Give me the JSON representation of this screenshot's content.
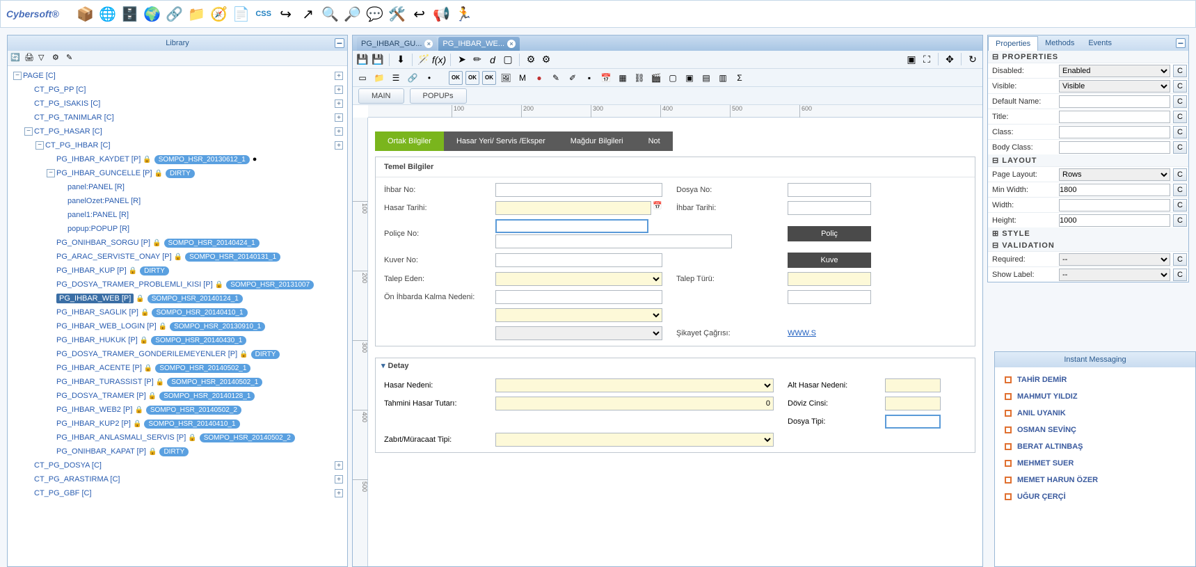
{
  "brand": "Cybersoft®",
  "library": {
    "title": "Library"
  },
  "tree": [
    {
      "d": 0,
      "exp": "-",
      "label": "PAGE [C]",
      "plus": true
    },
    {
      "d": 1,
      "exp": "",
      "label": "CT_PG_PP [C]",
      "plus": true
    },
    {
      "d": 1,
      "exp": "",
      "label": "CT_PG_ISAKIS [C]",
      "plus": true
    },
    {
      "d": 1,
      "exp": "",
      "label": "CT_PG_TANIMLAR [C]",
      "plus": true
    },
    {
      "d": 1,
      "exp": "-",
      "label": "CT_PG_HASAR [C]",
      "plus": true
    },
    {
      "d": 2,
      "exp": "-",
      "label": "CT_PG_IHBAR [C]",
      "plus": true
    },
    {
      "d": 3,
      "exp": "",
      "label": "PG_IHBAR_KAYDET [P]",
      "lock": "y",
      "badge": "SOMPO_HSR_20130612_1",
      "extra": "●"
    },
    {
      "d": 3,
      "exp": "-",
      "label": "PG_IHBAR_GUNCELLE [P]",
      "lock": "b",
      "badge": "DIRTY"
    },
    {
      "d": 4,
      "exp": "",
      "label": "panel:PANEL [R]"
    },
    {
      "d": 4,
      "exp": "",
      "label": "panelOzet:PANEL [R]"
    },
    {
      "d": 4,
      "exp": "",
      "label": "panel1:PANEL [R]"
    },
    {
      "d": 4,
      "exp": "",
      "label": "popup:POPUP [R]"
    },
    {
      "d": 3,
      "exp": "",
      "label": "PG_ONIHBAR_SORGU [P]",
      "lock": "y",
      "badge": "SOMPO_HSR_20140424_1"
    },
    {
      "d": 3,
      "exp": "",
      "label": "PG_ARAC_SERVISTE_ONAY [P]",
      "lock": "y",
      "badge": "SOMPO_HSR_20140131_1"
    },
    {
      "d": 3,
      "exp": "",
      "label": "PG_IHBAR_KUP [P]",
      "lock": "b",
      "badge": "DIRTY"
    },
    {
      "d": 3,
      "exp": "",
      "label": "PG_DOSYA_TRAMER_PROBLEMLI_KISI [P]",
      "lock": "y",
      "badge": "SOMPO_HSR_20131007"
    },
    {
      "d": 3,
      "exp": "",
      "label": "PG_IHBAR_WEB [P]",
      "lock": "y",
      "badge": "SOMPO_HSR_20140124_1",
      "selected": true
    },
    {
      "d": 3,
      "exp": "",
      "label": "PG_IHBAR_SAGLIK [P]",
      "lock": "y",
      "badge": "SOMPO_HSR_20140410_1"
    },
    {
      "d": 3,
      "exp": "",
      "label": "PG_IHBAR_WEB_LOGIN [P]",
      "lock": "y",
      "badge": "SOMPO_HSR_20130910_1"
    },
    {
      "d": 3,
      "exp": "",
      "label": "PG_IHBAR_HUKUK [P]",
      "lock": "y",
      "badge": "SOMPO_HSR_20140430_1"
    },
    {
      "d": 3,
      "exp": "",
      "label": "PG_DOSYA_TRAMER_GONDERILEMEYENLER [P]",
      "lock": "b",
      "badge": "DIRTY"
    },
    {
      "d": 3,
      "exp": "",
      "label": "PG_IHBAR_ACENTE [P]",
      "lock": "y",
      "badge": "SOMPO_HSR_20140502_1"
    },
    {
      "d": 3,
      "exp": "",
      "label": "PG_IHBAR_TURASSIST [P]",
      "lock": "y",
      "badge": "SOMPO_HSR_20140502_1"
    },
    {
      "d": 3,
      "exp": "",
      "label": "PG_DOSYA_TRAMER [P]",
      "lock": "y",
      "badge": "SOMPO_HSR_20140128_1"
    },
    {
      "d": 3,
      "exp": "",
      "label": "PG_IHBAR_WEB2 [P]",
      "lock": "y",
      "badge": "SOMPO_HSR_20140502_2"
    },
    {
      "d": 3,
      "exp": "",
      "label": "PG_IHBAR_KUP2 [P]",
      "lock": "y",
      "badge": "SOMPO_HSR_20140410_1"
    },
    {
      "d": 3,
      "exp": "",
      "label": "PG_IHBAR_ANLASMALI_SERVIS [P]",
      "lock": "y",
      "badge": "SOMPO_HSR_20140502_2"
    },
    {
      "d": 3,
      "exp": "",
      "label": "PG_ONIHBAR_KAPAT [P]",
      "lock": "b",
      "badge": "DIRTY"
    },
    {
      "d": 1,
      "exp": "",
      "label": "CT_PG_DOSYA [C]",
      "plus": true
    },
    {
      "d": 1,
      "exp": "",
      "label": "CT_PG_ARASTIRMA [C]",
      "plus": true
    },
    {
      "d": 1,
      "exp": "",
      "label": "CT_PG_GBF [C]",
      "plus": true
    }
  ],
  "editor_tabs": [
    {
      "label": "PG_IHBAR_GU...",
      "active": false
    },
    {
      "label": "PG_IHBAR_WE...",
      "active": true
    }
  ],
  "subtabs": {
    "main": "MAIN",
    "popups": "POPUPs"
  },
  "ruler_h": [
    100,
    200,
    300,
    400,
    500,
    600
  ],
  "ruler_v": [
    100,
    200,
    300,
    400,
    500
  ],
  "form": {
    "tabs": [
      "Ortak Bilgiler",
      "Hasar Yeri/ Servis /Eksper",
      "Mağdur Bilgileri",
      "Not"
    ],
    "panel_title": "Temel Bilgiler",
    "fields": {
      "ihbar_no": "İhbar No:",
      "dosya_no": "Dosya No:",
      "hasar_tarihi": "Hasar Tarihi:",
      "ihbar_tarihi": "İhbar Tarihi:",
      "police_no": "Poliçe No:",
      "police_btn": "Poliç",
      "kuver_no": "Kuver No:",
      "kuver_btn": "Kuve",
      "talep_eden": "Talep Eden:",
      "talep_turu": "Talep Türü:",
      "on_ihbar": "Ön İhbarda Kalma Nedeni:",
      "sikayet": "Şikayet Çağrısı:",
      "link": "WWW.S"
    },
    "detay": {
      "title": "Detay",
      "hasar_nedeni": "Hasar Nedeni:",
      "alt_hasar": "Alt Hasar Nedeni:",
      "tahmini": "Tahmini Hasar Tutarı:",
      "tahmini_val": "0",
      "doviz": "Döviz Cinsi:",
      "dosya_tipi": "Dosya Tipi:",
      "zabit": "Zabıt/Müracaat Tipi:"
    }
  },
  "props": {
    "tabs": [
      "Properties",
      "Methods",
      "Events"
    ],
    "sec_properties": "PROPERTIES",
    "disabled": {
      "label": "Disabled:",
      "value": "Enabled"
    },
    "visible": {
      "label": "Visible:",
      "value": "Visible"
    },
    "default_name": {
      "label": "Default Name:",
      "value": ""
    },
    "title": {
      "label": "Title:",
      "value": ""
    },
    "class": {
      "label": "Class:",
      "value": ""
    },
    "body_class": {
      "label": "Body Class:",
      "value": ""
    },
    "sec_layout": "LAYOUT",
    "page_layout": {
      "label": "Page Layout:",
      "value": "Rows"
    },
    "min_width": {
      "label": "Min Width:",
      "value": "1800"
    },
    "width": {
      "label": "Width:",
      "value": ""
    },
    "height": {
      "label": "Height:",
      "value": "1000"
    },
    "sec_style": "STYLE",
    "sec_validation": "VALIDATION",
    "required": {
      "label": "Required:",
      "value": "--"
    },
    "show_label": {
      "label": "Show Label:",
      "value": "--"
    },
    "c": "C"
  },
  "im": {
    "title": "Instant Messaging",
    "users": [
      "TAHİR DEMİR",
      "MAHMUT YILDIZ",
      "ANIL UYANIK",
      "OSMAN SEVİNÇ",
      "BERAT ALTINBAŞ",
      "MEHMET SUER",
      "MEMET HARUN ÖZER",
      "UĞUR ÇERÇİ"
    ]
  }
}
